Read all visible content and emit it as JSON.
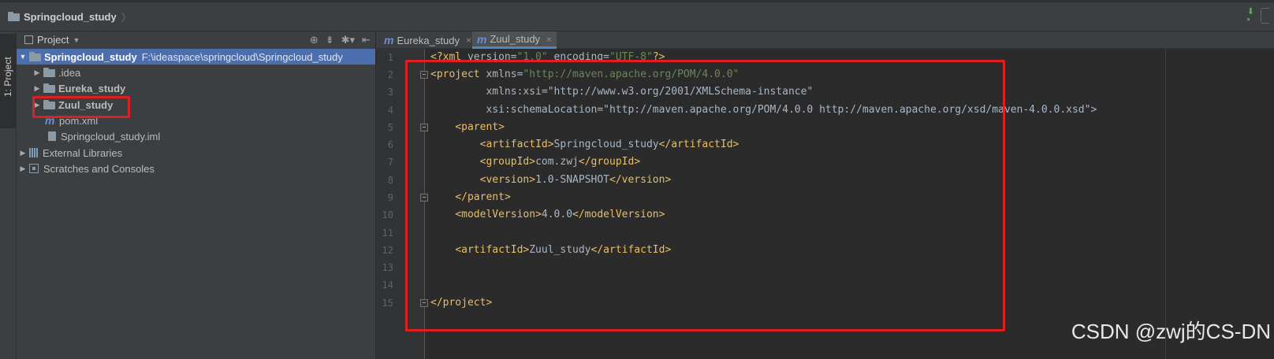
{
  "navbar": {
    "breadcrumb": "Springcloud_study"
  },
  "tool_window_stripe": {
    "label": "1: Project"
  },
  "project_panel": {
    "title": "Project",
    "tree": [
      {
        "label": "Springcloud_study",
        "path": "F:\\ideaspace\\springcloud\\Springcloud_study",
        "level": 0,
        "expanded": true,
        "selected": true,
        "icon": "module-folder-icon"
      },
      {
        "label": ".idea",
        "level": 1,
        "expanded": false,
        "icon": "folder-icon"
      },
      {
        "label": "Eureka_study",
        "level": 1,
        "expanded": false,
        "icon": "module-folder-icon"
      },
      {
        "label": "Zuul_study",
        "level": 1,
        "expanded": false,
        "icon": "module-folder-icon",
        "highlighted": true
      },
      {
        "label": "pom.xml",
        "level": 1,
        "icon": "maven-icon"
      },
      {
        "label": "Springcloud_study.iml",
        "level": 1,
        "icon": "iml-file-icon"
      },
      {
        "label": "External Libraries",
        "level": 0,
        "expanded": false,
        "icon": "library-icon"
      },
      {
        "label": "Scratches and Consoles",
        "level": 0,
        "expanded": false,
        "icon": "scratches-icon"
      }
    ]
  },
  "editor": {
    "tabs": [
      {
        "label": "Eureka_study",
        "active": false
      },
      {
        "label": "Zuul_study",
        "active": true
      }
    ],
    "line_numbers": [
      "1",
      "2",
      "3",
      "4",
      "5",
      "6",
      "7",
      "8",
      "9",
      "10",
      "11",
      "12",
      "13",
      "14",
      "15"
    ],
    "lines": [
      "<?xml version=\"1.0\" encoding=\"UTF-8\"?>",
      "<project xmlns=\"http://maven.apache.org/POM/4.0.0\"",
      "         xmlns:xsi=\"http://www.w3.org/2001/XMLSchema-instance\"",
      "         xsi:schemaLocation=\"http://maven.apache.org/POM/4.0.0 http://maven.apache.org/xsd/maven-4.0.0.xsd\">",
      "    <parent>",
      "        <artifactId>Springcloud_study</artifactId>",
      "        <groupId>com.zwj</groupId>",
      "        <version>1.0-SNAPSHOT</version>",
      "    </parent>",
      "    <modelVersion>4.0.0</modelVersion>",
      "",
      "    <artifactId>Zuul_study</artifactId>",
      "",
      "",
      "</project>"
    ]
  },
  "watermark": "CSDN @zwj的CS-DN",
  "colors": {
    "selection": "#4b6eaf",
    "annotation_box": "#e02020",
    "xml_tag": "#e8bf6a",
    "xml_value": "#6a8759",
    "xml_namespace": "#9876aa"
  }
}
